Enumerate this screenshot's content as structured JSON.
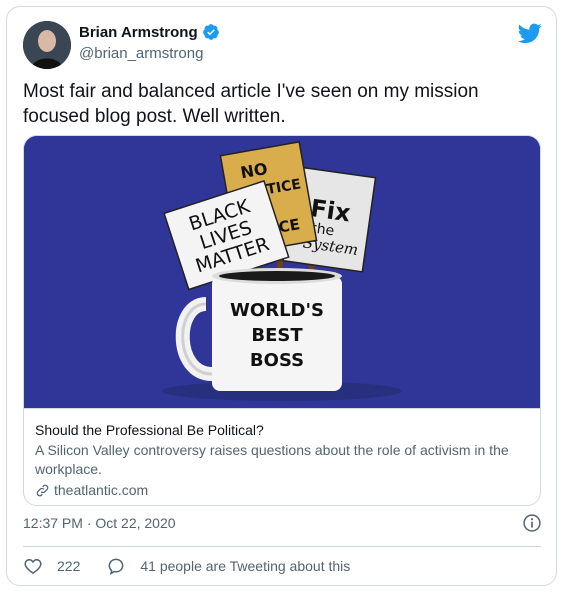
{
  "author": {
    "name": "Brian Armstrong",
    "handle": "@brian_armstrong",
    "verified": true,
    "avatar_icon": "avatar-photo"
  },
  "tweet": {
    "text": "Most fair and balanced article I've seen on my mission focused blog post. Well written."
  },
  "link_card": {
    "image_texts": {
      "sign_blm": [
        "BLACK",
        "LIVES",
        "MATTER"
      ],
      "sign_justice": [
        "NO",
        "JUSTICE",
        "CE"
      ],
      "sign_fix": [
        "Fix",
        "the",
        "System"
      ],
      "mug": [
        "WORLD'S",
        "BEST",
        "BOSS"
      ]
    },
    "title": "Should the Professional Be Political?",
    "description": "A Silicon Valley controversy raises questions about the role of activism in the workplace.",
    "domain": "theatlantic.com"
  },
  "meta": {
    "timestamp": "12:37 PM · Oct 22, 2020"
  },
  "actions": {
    "like_count": "222",
    "reply_text": "41 people are Tweeting about this"
  },
  "colors": {
    "twitter_blue": "#1d9bf0",
    "image_background": "#2f3697",
    "text_primary": "#0f1419",
    "text_secondary": "#536471",
    "border": "#cfd9de"
  }
}
